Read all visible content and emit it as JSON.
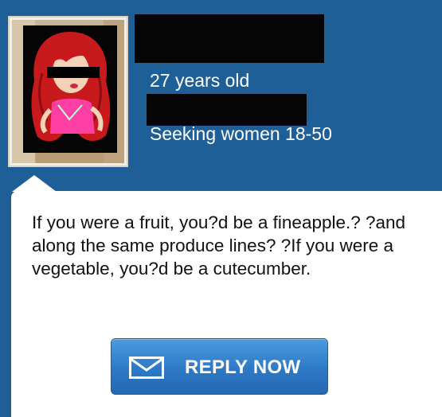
{
  "profile": {
    "age": "27 years old",
    "seeking": "Seeking women 18-50"
  },
  "message": {
    "text": "If you were a fruit, you?d be a fineapple.? ?and along the same produce lines? ?If you were a vegetable, you?d be a cutecumber."
  },
  "reply_button": {
    "label": "REPLY NOW",
    "icon": "envelope-icon"
  },
  "colors": {
    "background": "#1e5f97",
    "bubble": "#ffffff",
    "button": "#2e79c6"
  }
}
